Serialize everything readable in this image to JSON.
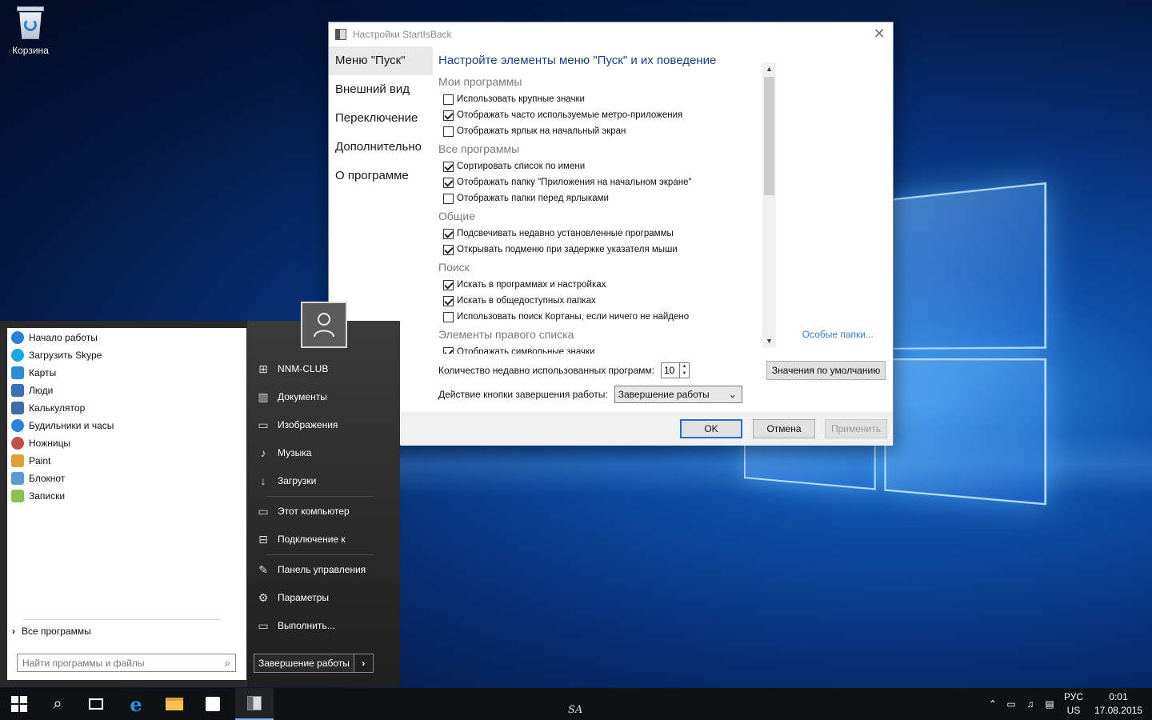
{
  "desktop": {
    "recycle_bin_label": "Корзина"
  },
  "dialog": {
    "title": "Настройки StartIsBack",
    "nav": [
      {
        "label": "Меню \"Пуск\""
      },
      {
        "label": "Внешний вид"
      },
      {
        "label": "Переключение"
      },
      {
        "label": "Дополнительно"
      },
      {
        "label": "О программе"
      }
    ],
    "content_title": "Настройте элементы меню \"Пуск\" и их поведение",
    "groups": [
      {
        "title": "Мои программы",
        "options": [
          {
            "label": "Использовать крупные значки",
            "checked": false
          },
          {
            "label": "Отображать часто используемые метро-приложения",
            "checked": true
          },
          {
            "label": "Отображать ярлык на начальный экран",
            "checked": false
          }
        ]
      },
      {
        "title": "Все программы",
        "options": [
          {
            "label": "Сортировать список по имени",
            "checked": true
          },
          {
            "label": "Отображать папку \"Приложения на начальном экране\"",
            "checked": true
          },
          {
            "label": "Отображать папки перед ярлыками",
            "checked": false
          }
        ]
      },
      {
        "title": "Общие",
        "options": [
          {
            "label": "Подсвечивать недавно установленные программы",
            "checked": true
          },
          {
            "label": "Открывать подменю при задержке указателя мыши",
            "checked": true
          }
        ]
      },
      {
        "title": "Поиск",
        "options": [
          {
            "label": "Искать в программах и настройках",
            "checked": true
          },
          {
            "label": "Искать в общедоступных папках",
            "checked": true
          },
          {
            "label": "Использовать поиск Кортаны, если ничего не найдено",
            "checked": false
          }
        ]
      },
      {
        "title": "Элементы правого списка",
        "link": "Особые папки...",
        "options": [
          {
            "label": "Отображать символьные значки",
            "checked": true
          }
        ]
      }
    ],
    "recent_label": "Количество недавно использованных программ:",
    "recent_value": "10",
    "defaults_button": "Значения по умолчанию",
    "power_label": "Действие кнопки завершения работы:",
    "power_value": "Завершение работы",
    "ok": "OK",
    "cancel": "Отмена",
    "apply": "Применить"
  },
  "start_menu": {
    "programs": [
      {
        "label": "Начало работы",
        "color": "#2b7fd8"
      },
      {
        "label": "Загрузить Skype",
        "color": "#17a9e1"
      },
      {
        "label": "Карты",
        "color": "#2a8fd6"
      },
      {
        "label": "Люди",
        "color": "#3a6fb8"
      },
      {
        "label": "Калькулятор",
        "color": "#3c6db0"
      },
      {
        "label": "Будильники и часы",
        "color": "#2c84d9"
      },
      {
        "label": "Ножницы",
        "color": "#c0504d"
      },
      {
        "label": "Paint",
        "color": "#e0a030"
      },
      {
        "label": "Блокнот",
        "color": "#5b9bd5"
      },
      {
        "label": "Записки",
        "color": "#8cc152"
      }
    ],
    "all_programs": "Все программы",
    "search_placeholder": "Найти программы и файлы",
    "places": [
      {
        "label": "NNM-CLUB",
        "icon": "user-folder-icon"
      },
      {
        "label": "Документы",
        "icon": "documents-icon"
      },
      {
        "label": "Изображения",
        "icon": "pictures-icon"
      },
      {
        "label": "Музыка",
        "icon": "music-icon"
      },
      {
        "label": "Загрузки",
        "icon": "downloads-icon"
      },
      {
        "label": "Этот компьютер",
        "icon": "computer-icon"
      },
      {
        "label": "Подключение к",
        "icon": "network-icon"
      },
      {
        "label": "Панель управления",
        "icon": "control-panel-icon"
      },
      {
        "label": "Параметры",
        "icon": "gear-icon"
      },
      {
        "label": "Выполнить...",
        "icon": "run-icon"
      }
    ],
    "shutdown_label": "Завершение работы"
  },
  "taskbar": {
    "signature": "SA",
    "lang_top": "РУС",
    "lang_bottom": "US",
    "time": "0:01",
    "date": "17.08.2015"
  }
}
